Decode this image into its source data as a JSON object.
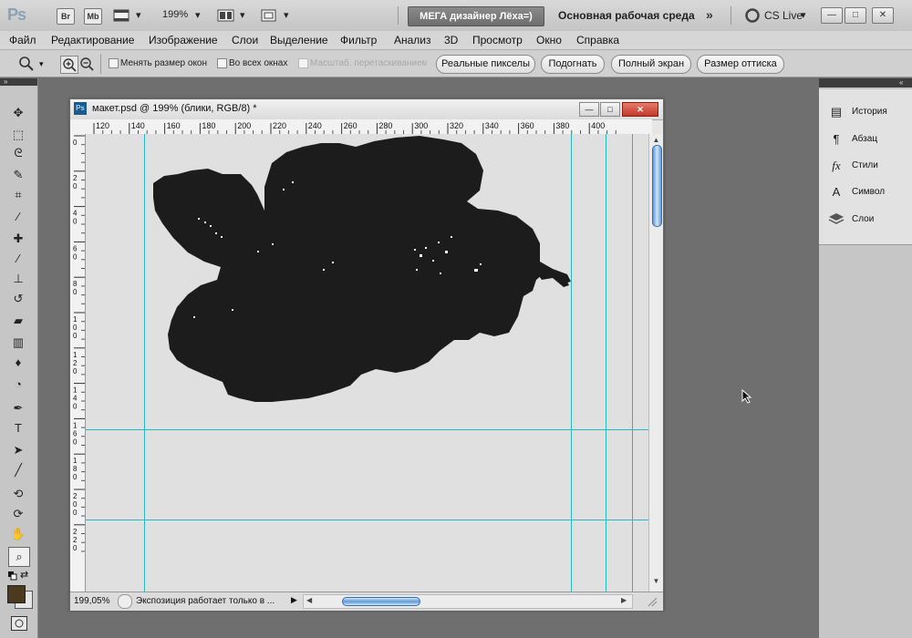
{
  "appbar": {
    "logo": "Ps",
    "br": "Br",
    "mb": "Mb",
    "zoom": "199%",
    "dropdown_caret": "▾",
    "workspace_btn": "МЕГА дизайнер Лёха=)",
    "workspace_name": "Основная рабочая среда",
    "more": "»",
    "cslive": "CS Live",
    "win_buttons": [
      "—",
      "□",
      "✕"
    ]
  },
  "menu": [
    "Файл",
    "Редактирование",
    "Изображение",
    "Слои",
    "Выделение",
    "Фильтр",
    "Анализ",
    "3D",
    "Просмотр",
    "Окно",
    "Справка"
  ],
  "options": {
    "resize_windows": "Менять размер окон",
    "all_windows": "Во всех окнах",
    "scrubby_zoom": "Масштаб. перетаскиванием",
    "actual_pixels": "Реальные пикселы",
    "fit_screen": "Подогнать",
    "full_screen": "Полный экран",
    "print_size": "Размер оттиска"
  },
  "tools": [
    "move-tool",
    "marquee-tool",
    "lasso-tool",
    "quick-select-tool",
    "crop-tool",
    "eyedropper-tool",
    "spot-heal-tool",
    "brush-tool",
    "clone-stamp-tool",
    "history-brush-tool",
    "eraser-tool",
    "gradient-tool",
    "blur-tool",
    "dodge-tool",
    "pen-tool",
    "type-tool",
    "path-select-tool",
    "line-tool",
    "3d-rotate-tool",
    "3d-orbit-tool",
    "hand-tool",
    "zoom-tool"
  ],
  "colors": {
    "foreground": "#4b3a1e",
    "background": "#e6e6e6",
    "guide": "#27b8c8",
    "shape": "#1c1c1c"
  },
  "panels": [
    {
      "icon": "history-icon",
      "label": "История"
    },
    {
      "icon": "paragraph-icon",
      "label": "Абзац"
    },
    {
      "icon": "styles-icon",
      "label": "Стили"
    },
    {
      "icon": "character-icon",
      "label": "Символ"
    },
    {
      "icon": "layers-icon",
      "label": "Слои"
    }
  ],
  "document": {
    "title": "макет.psd @ 199% (блики, RGB/8) *",
    "badge": "Ps",
    "ruler_h": [
      "120",
      "140",
      "160",
      "180",
      "200",
      "220",
      "240",
      "260",
      "280",
      "300",
      "320",
      "340",
      "360",
      "380",
      "400"
    ],
    "ruler_v": [
      [
        "0"
      ],
      [
        "2",
        "0"
      ],
      [
        "4",
        "0"
      ],
      [
        "6",
        "0"
      ],
      [
        "8",
        "0"
      ],
      [
        "1",
        "0",
        "0"
      ],
      [
        "1",
        "2",
        "0"
      ],
      [
        "1",
        "4",
        "0"
      ],
      [
        "1",
        "6",
        "0"
      ],
      [
        "1",
        "8",
        "0"
      ],
      [
        "2",
        "0",
        "0"
      ],
      [
        "2",
        "2",
        "0"
      ]
    ],
    "zoom_status": "199,05%",
    "status_text": "Экспозиция работает только в ..."
  }
}
